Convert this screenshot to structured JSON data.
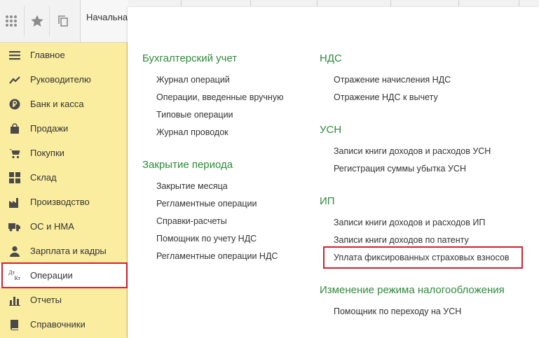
{
  "topbar": {
    "start_tab_label": "Начальна",
    "icons": [
      "apps-grid-icon",
      "star-icon",
      "history-icon"
    ]
  },
  "sidebar": {
    "items": [
      {
        "label": "Главное",
        "icon": "list-icon"
      },
      {
        "label": "Руководителю",
        "icon": "trend-chart-icon"
      },
      {
        "label": "Банк и касса",
        "icon": "ruble-coin-icon"
      },
      {
        "label": "Продажи",
        "icon": "shopping-bag-icon"
      },
      {
        "label": "Покупки",
        "icon": "cart-icon"
      },
      {
        "label": "Склад",
        "icon": "warehouse-grid-icon"
      },
      {
        "label": "Производство",
        "icon": "factory-icon"
      },
      {
        "label": "ОС и НМА",
        "icon": "truck-icon"
      },
      {
        "label": "Зарплата и кадры",
        "icon": "person-icon"
      },
      {
        "label": "Операции",
        "icon": "debit-credit-icon",
        "icon_text_top": "Дт",
        "icon_text_bottom": "Кт",
        "selected": true
      },
      {
        "label": "Отчеты",
        "icon": "bar-chart-icon"
      },
      {
        "label": "Справочники",
        "icon": "book-icon"
      }
    ]
  },
  "colors": {
    "sidebar_bg": "#fbeda0",
    "section_title": "#2e8b3a",
    "highlight": "#d4202f"
  },
  "content": {
    "sections": [
      {
        "title": "Бухгалтерский учет",
        "links": [
          "Журнал операций",
          "Операции, введенные вручную",
          "Типовые операции",
          "Журнал проводок"
        ]
      },
      {
        "title": "Закрытие периода",
        "links": [
          "Закрытие месяца",
          "Регламентные операции",
          "Справки-расчеты",
          "Помощник по учету НДС",
          "Регламентные операции НДС"
        ]
      },
      {
        "title": "НДС",
        "links": [
          "Отражение начисления НДС",
          "Отражение НДС к вычету"
        ]
      },
      {
        "title": "УСН",
        "links": [
          "Записи книги доходов и расходов УСН",
          "Регистрация суммы убытка УСН"
        ]
      },
      {
        "title": "ИП",
        "links": [
          "Записи книги доходов и расходов ИП",
          "Записи книги доходов по патенту",
          "Уплата фиксированных страховых взносов"
        ]
      },
      {
        "title": "Изменение режима налогообложения",
        "links": [
          "Помощник по переходу на УСН"
        ]
      }
    ]
  }
}
